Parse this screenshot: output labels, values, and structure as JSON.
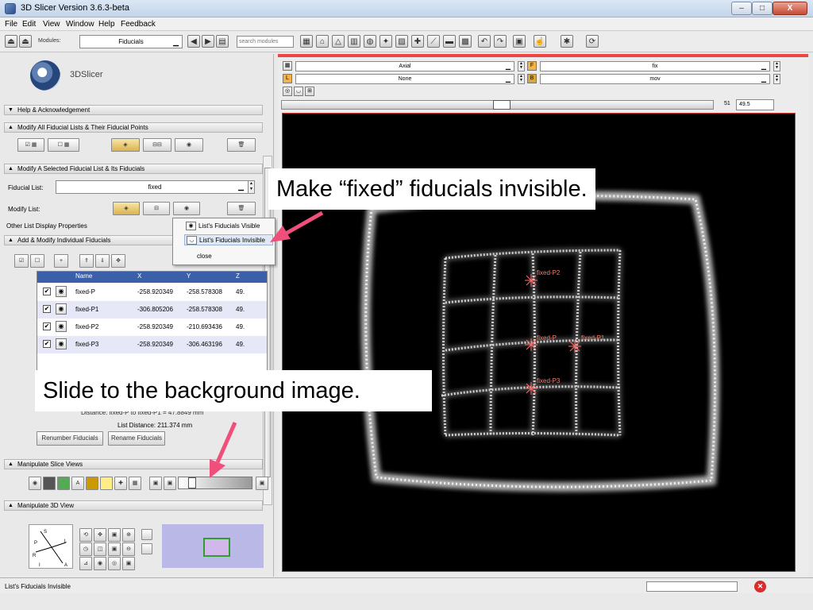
{
  "window": {
    "title": "3D Slicer Version 3.6.3-beta",
    "btn_min": "–",
    "btn_max": "□",
    "btn_close": "X"
  },
  "menu": [
    "File",
    "Edit",
    "View",
    "Window",
    "Help",
    "Feedback"
  ],
  "toolbar": {
    "modules_label": "Modules:",
    "module_selected": "Fiducials",
    "search_placeholder": "search modules"
  },
  "logo": {
    "name": "3DSlicer"
  },
  "sections": {
    "help": "Help & Acknowledgement",
    "modify_all": "Modify All Fiducial Lists & Their Fiducial Points",
    "modify_selected": "Modify A Selected Fiducial List & Its Fiducials",
    "add_modify": "Add & Modify Individual Fiducials",
    "slice_views": "Manipulate Slice Views",
    "view_3d": "Manipulate 3D View"
  },
  "fiducial_list": {
    "label": "Fiducial List:",
    "value": "fixed"
  },
  "modify_list": {
    "label": "Modify List:",
    "other_props": "Other List Display Properties"
  },
  "popup": {
    "item_visible": "List's Fiducials Visible",
    "item_invisible": "List's Fiducials Invisible",
    "close": "close"
  },
  "table": {
    "headers": [
      "Name",
      "X",
      "Y",
      "Z"
    ],
    "rows": [
      {
        "name": "fixed-P",
        "x": "-258.920349",
        "y": "-258.578308",
        "z": "49."
      },
      {
        "name": "fixed-P1",
        "x": "-306.805206",
        "y": "-258.578308",
        "z": "49."
      },
      {
        "name": "fixed-P2",
        "x": "-258.920349",
        "y": "-210.693436",
        "z": "49."
      },
      {
        "name": "fixed-P3",
        "x": "-258.920349",
        "y": "-306.463196",
        "z": "49."
      }
    ]
  },
  "distance": {
    "pair": "Distance: fixed-P to fixed-P1 = 47.8849 mm",
    "list": "List Distance: 211.374 mm"
  },
  "buttons": {
    "renumber": "Renumber Fiducials",
    "rename": "Rename Fiducials"
  },
  "view": {
    "orientation": "Axial",
    "foreground": "fix",
    "label_layer": "None",
    "background": "mov",
    "slice_number": "51",
    "slice_offset": "49.5"
  },
  "fiducials_in_view": [
    {
      "label": "fixed-P2"
    },
    {
      "label": "fixed-P"
    },
    {
      "label": "fixed-P1"
    },
    {
      "label": "fixed-P3"
    }
  ],
  "status": {
    "text": "List's Fiducials Invisible"
  },
  "callouts": {
    "invisible": "Make “fixed” fiducials invisible.",
    "slide": "Slide to the background image."
  },
  "colors": {
    "accent_red": "#e44444",
    "arrow_pink": "#ef4f7a",
    "table_header": "#3b5fa8",
    "fiducial_label": "#ff7b6b"
  }
}
